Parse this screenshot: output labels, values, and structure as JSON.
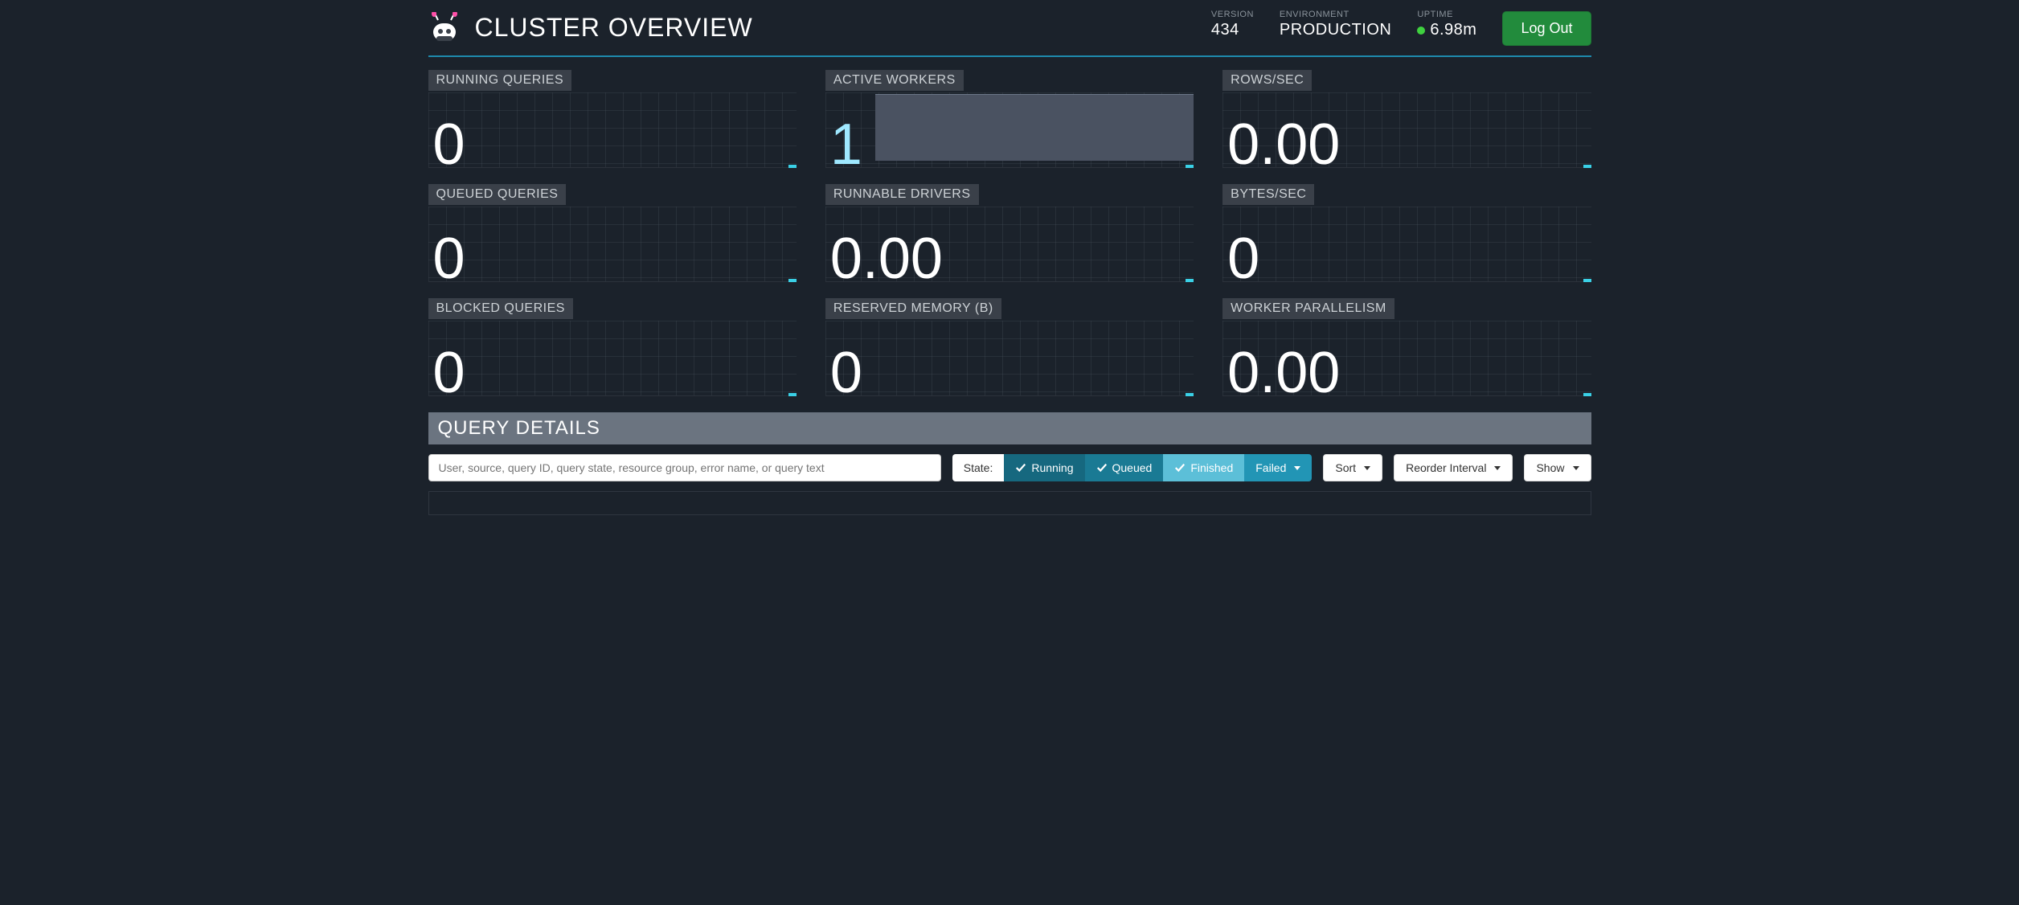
{
  "header": {
    "title": "CLUSTER OVERVIEW",
    "version_label": "VERSION",
    "version_value": "434",
    "environment_label": "ENVIRONMENT",
    "environment_value": "PRODUCTION",
    "uptime_label": "UPTIME",
    "uptime_value": "6.98m",
    "logout_label": "Log Out",
    "status_color": "#3fd13f"
  },
  "stats": {
    "running_queries": {
      "label": "RUNNING QUERIES",
      "value": "0"
    },
    "active_workers": {
      "label": "ACTIVE WORKERS",
      "value": "1",
      "highlight": true
    },
    "rows_sec": {
      "label": "ROWS/SEC",
      "value": "0.00"
    },
    "queued_queries": {
      "label": "QUEUED QUERIES",
      "value": "0"
    },
    "runnable_drivers": {
      "label": "RUNNABLE DRIVERS",
      "value": "0.00"
    },
    "bytes_sec": {
      "label": "BYTES/SEC",
      "value": "0"
    },
    "blocked_queries": {
      "label": "BLOCKED QUERIES",
      "value": "0"
    },
    "reserved_memory": {
      "label": "RESERVED MEMORY (B)",
      "value": "0"
    },
    "worker_parallelism": {
      "label": "WORKER PARALLELISM",
      "value": "0.00"
    }
  },
  "query_details": {
    "title": "QUERY DETAILS",
    "search_placeholder": "User, source, query ID, query state, resource group, error name, or query text",
    "state_label": "State:",
    "filters": {
      "running": "Running",
      "queued": "Queued",
      "finished": "Finished",
      "failed": "Failed"
    },
    "sort_label": "Sort",
    "reorder_label": "Reorder Interval",
    "show_label": "Show"
  }
}
